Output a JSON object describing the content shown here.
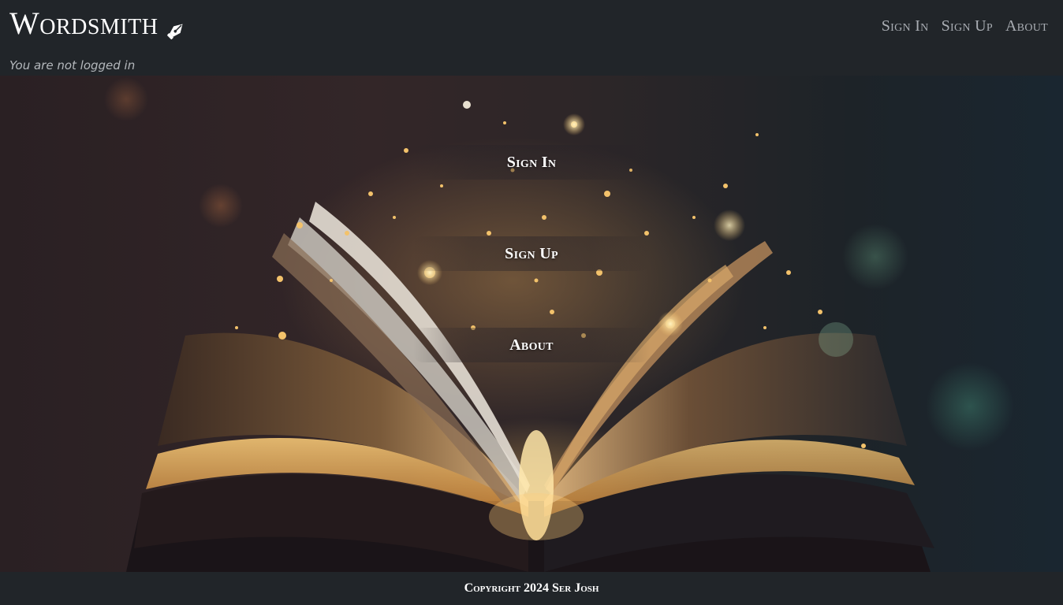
{
  "navbar": {
    "brand": "Wordsmith",
    "brand_icon": "pen-nib-icon",
    "links": [
      {
        "label": "Sign In"
      },
      {
        "label": "Sign Up"
      },
      {
        "label": "About"
      }
    ]
  },
  "status": {
    "text": "You are not logged in"
  },
  "hero": {
    "image": "open-book-with-sparkles",
    "menu": [
      {
        "label": "Sign In"
      },
      {
        "label": "Sign Up"
      },
      {
        "label": "About"
      }
    ]
  },
  "footer": {
    "text": "Copyright 2024 Ser Josh"
  },
  "colors": {
    "navbar_bg": "#212529",
    "nav_link": "#a9adb3",
    "status_text": "#b4b8bc",
    "accent_gold": "#f3c26b"
  }
}
